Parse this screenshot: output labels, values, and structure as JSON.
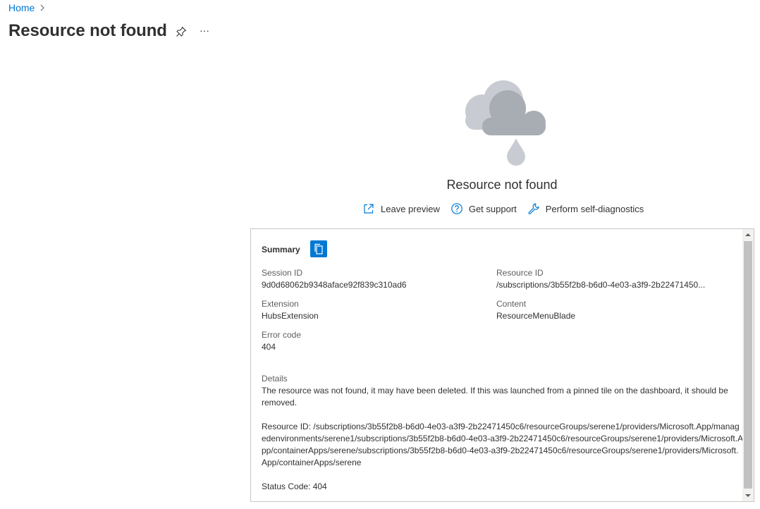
{
  "breadcrumb": {
    "home": "Home"
  },
  "page": {
    "title": "Resource not found"
  },
  "message": {
    "title": "Resource not found"
  },
  "actions": [
    {
      "label": "Leave preview",
      "icon": "external-link-icon"
    },
    {
      "label": "Get support",
      "icon": "help-circle-icon"
    },
    {
      "label": "Perform self-diagnostics",
      "icon": "wrench-icon"
    }
  ],
  "summary": {
    "title": "Summary",
    "session_id": {
      "label": "Session ID",
      "value": "9d0d68062b9348aface92f839c310ad6"
    },
    "resource_id": {
      "label": "Resource ID",
      "value": "/subscriptions/3b55f2b8-b6d0-4e03-a3f9-2b22471450..."
    },
    "extension": {
      "label": "Extension",
      "value": "HubsExtension"
    },
    "content": {
      "label": "Content",
      "value": "ResourceMenuBlade"
    },
    "error_code": {
      "label": "Error code",
      "value": "404"
    },
    "details": {
      "label": "Details",
      "text": "The resource was not found, it may have been deleted. If this was launched from a pinned tile on the dashboard, it should be removed.",
      "resource_line": "Resource ID: /subscriptions/3b55f2b8-b6d0-4e03-a3f9-2b22471450c6/resourceGroups/serene1/providers/Microsoft.App/managedenvironments/serene1/subscriptions/3b55f2b8-b6d0-4e03-a3f9-2b22471450c6/resourceGroups/serene1/providers/Microsoft.App/containerApps/serene/subscriptions/3b55f2b8-b6d0-4e03-a3f9-2b22471450c6/resourceGroups/serene1/providers/Microsoft.App/containerApps/serene",
      "status": "Status Code: 404"
    }
  },
  "colors": {
    "accent": "#0078d4",
    "cloud_light": "#c8ccd2",
    "cloud_dark": "#a8adb4"
  }
}
